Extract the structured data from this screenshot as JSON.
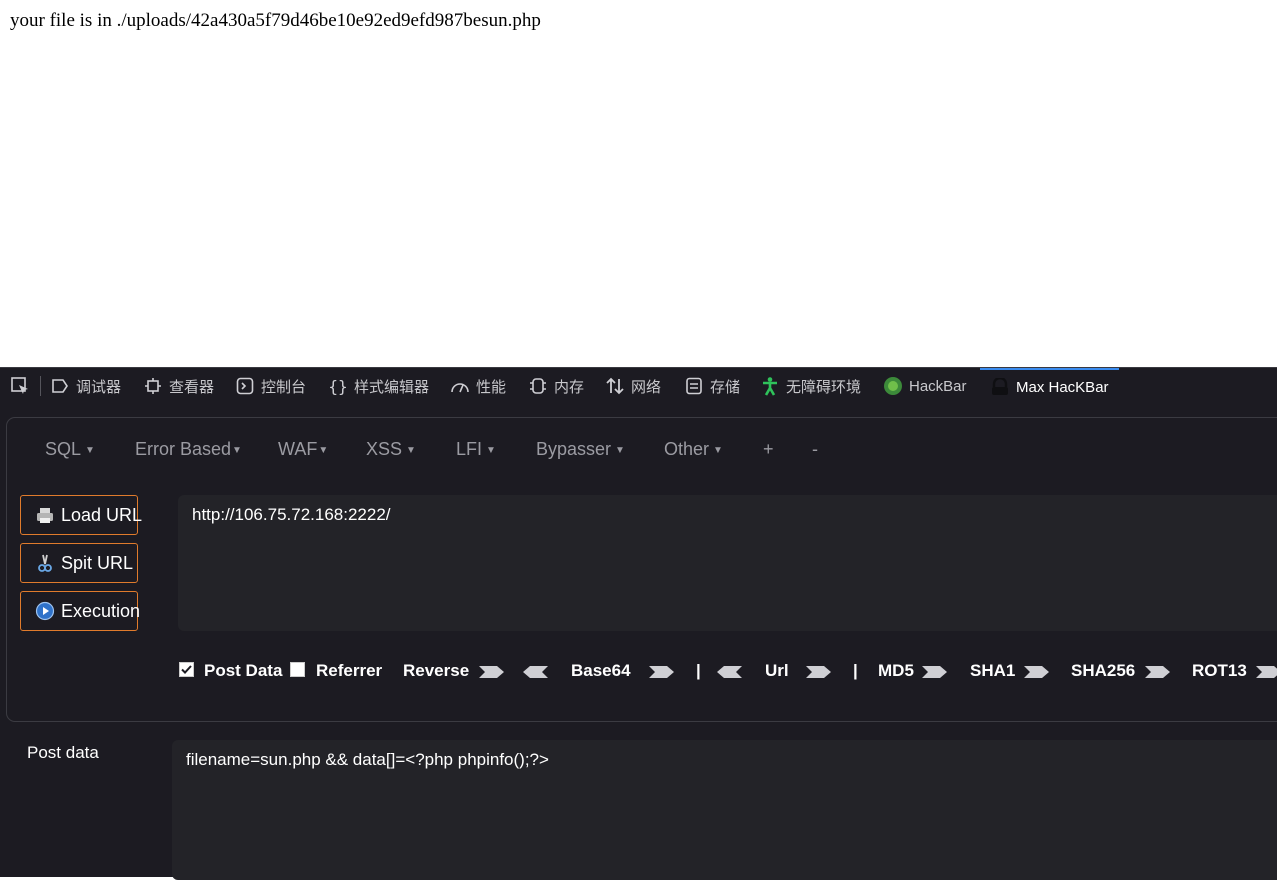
{
  "page": {
    "message": "your file is in ./uploads/42a430a5f79d46be10e92ed9efd987besun.php"
  },
  "devtools": {
    "tabs": [
      {
        "label": "调试器",
        "icon": "debugger-icon"
      },
      {
        "label": "查看器",
        "icon": "inspector-icon"
      },
      {
        "label": "控制台",
        "icon": "console-icon"
      },
      {
        "label": "样式编辑器",
        "icon": "style-editor-icon"
      },
      {
        "label": "性能",
        "icon": "performance-icon"
      },
      {
        "label": "内存",
        "icon": "memory-icon"
      },
      {
        "label": "网络",
        "icon": "network-icon"
      },
      {
        "label": "存储",
        "icon": "storage-icon"
      },
      {
        "label": "无障碍环境",
        "icon": "accessibility-icon"
      },
      {
        "label": "HackBar",
        "icon": "hackbar-icon"
      },
      {
        "label": "Max HacKBar",
        "icon": "max-hackbar-icon",
        "active": true
      }
    ]
  },
  "hackbar": {
    "menu": [
      "SQL",
      "Error Based",
      "WAF",
      "XSS",
      "LFI",
      "Bypasser",
      "Other",
      "+",
      "-"
    ],
    "buttons": {
      "load_url": "Load URL",
      "split_url": "Spit URL",
      "execution": "Execution"
    },
    "url": "http://106.75.72.168:2222/",
    "options": {
      "post_data": "Post Data",
      "post_data_checked": true,
      "referrer": "Referrer",
      "referrer_checked": false,
      "reverse": "Reverse",
      "base64": "Base64",
      "url": "Url",
      "md5": "MD5",
      "sha1": "SHA1",
      "sha256": "SHA256",
      "rot13": "ROT13",
      "divider": "|"
    },
    "post_label": "Post data",
    "post_value": "filename=sun.php && data[]=<?php phpinfo();?>"
  }
}
